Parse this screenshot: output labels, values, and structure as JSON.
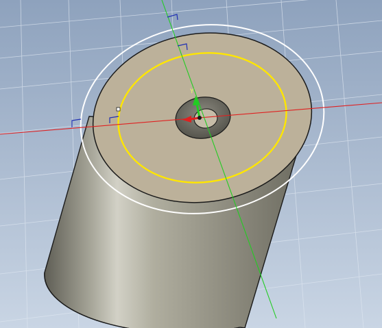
{
  "viewport": {
    "kind": "3d-modeling-viewport",
    "background_top": "#8ea2bd",
    "background_bottom": "#c9d5e4",
    "grid_color": "#dfe7f1"
  },
  "axes": {
    "x_axis_color": "#e02020",
    "y_axis_color": "#22cc22",
    "origin_marker_label": "Y"
  },
  "part": {
    "shape": "cylinder-with-center-hole",
    "top_face_color": "#bcb19a",
    "side_face_color_light": "#c9c8be",
    "side_face_color_dark": "#6f6e63",
    "hole_color": "#6d6b63",
    "edge_color": "#1a1a1a"
  },
  "sketch": {
    "circle_color": "#ffe600",
    "selection_circle_color": "#ffffff",
    "dimension_bracket_color": "#1f2fb3"
  }
}
